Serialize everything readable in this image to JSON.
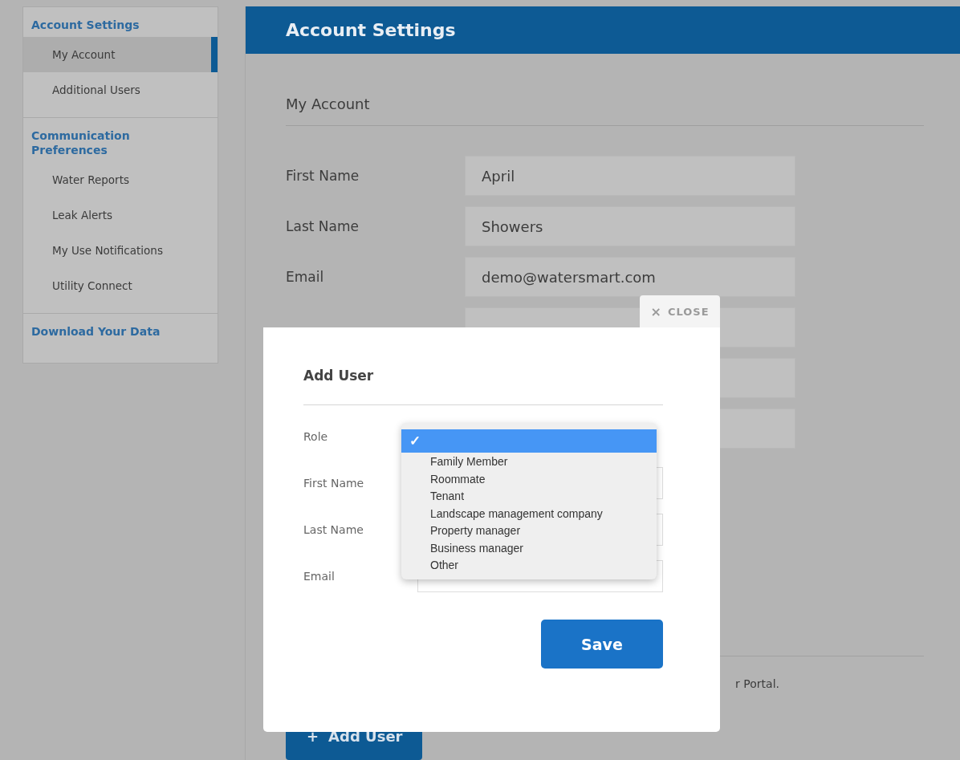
{
  "sidebar": {
    "sections": [
      {
        "heading": "Account Settings",
        "items": [
          {
            "label": "My Account",
            "selected": true
          },
          {
            "label": "Additional Users",
            "selected": false
          }
        ]
      },
      {
        "heading": "Communication Preferences",
        "items": [
          {
            "label": "Water Reports",
            "selected": false
          },
          {
            "label": "Leak Alerts",
            "selected": false
          },
          {
            "label": "My Use Notifications",
            "selected": false
          },
          {
            "label": "Utility Connect",
            "selected": false
          }
        ]
      },
      {
        "heading": "Download Your Data"
      }
    ]
  },
  "header": {
    "title": "Account Settings"
  },
  "account": {
    "heading": "My Account",
    "fields": [
      {
        "kind": "filled",
        "label": "First Name",
        "value": "April"
      },
      {
        "kind": "filled",
        "label": "Last Name",
        "value": "Showers"
      },
      {
        "kind": "filled",
        "label": "Email",
        "value": "demo@watersmart.com"
      },
      {
        "kind": "covered"
      },
      {
        "kind": "covered"
      },
      {
        "kind": "covered"
      }
    ],
    "note": "r Portal.",
    "add_button": {
      "icon": "+",
      "label": "Add User"
    }
  },
  "modal": {
    "close": {
      "icon": "×",
      "label": "CLOSE"
    },
    "title": "Add User",
    "fields": [
      {
        "label": "Role",
        "kind": "select"
      },
      {
        "label": "First Name",
        "kind": "text"
      },
      {
        "label": "Last Name",
        "kind": "text"
      },
      {
        "label": "Email",
        "kind": "text"
      }
    ],
    "dropdown": {
      "blank_option": {
        "check": "✓",
        "selected": true
      },
      "options": [
        {
          "label": "Family Member",
          "selected": false
        },
        {
          "label": "Roommate",
          "selected": false
        },
        {
          "label": "Tenant",
          "selected": false
        },
        {
          "label": "Landscape management company",
          "selected": false
        },
        {
          "label": "Property manager",
          "selected": false
        },
        {
          "label": "Business manager",
          "selected": false
        },
        {
          "label": "Other",
          "selected": false
        }
      ]
    },
    "save_button": "Save"
  }
}
